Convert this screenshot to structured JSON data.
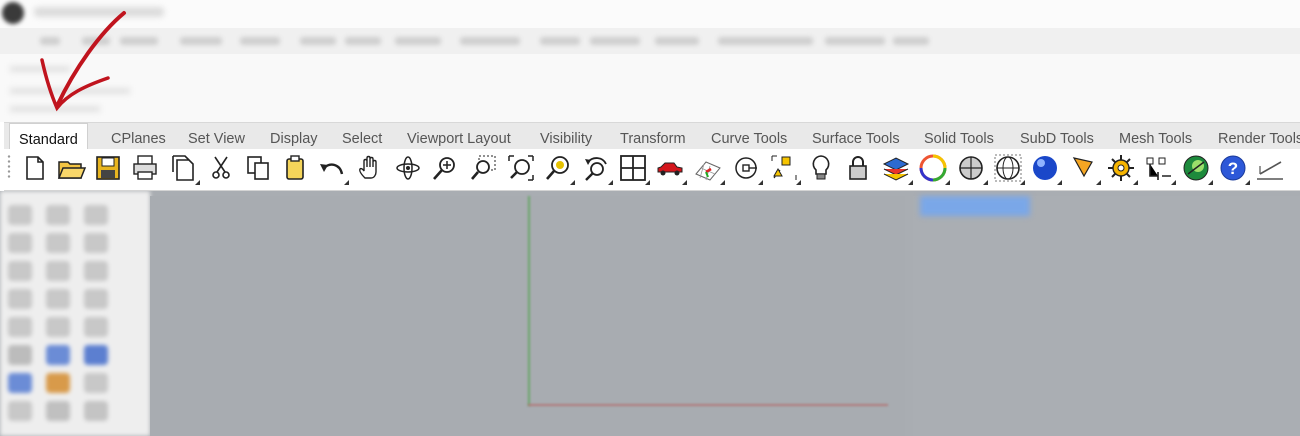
{
  "tabs": [
    {
      "label": "Standard",
      "active": true
    },
    {
      "label": "CPlanes",
      "active": false
    },
    {
      "label": "Set View",
      "active": false
    },
    {
      "label": "Display",
      "active": false
    },
    {
      "label": "Select",
      "active": false
    },
    {
      "label": "Viewport Layout",
      "active": false
    },
    {
      "label": "Visibility",
      "active": false
    },
    {
      "label": "Transform",
      "active": false
    },
    {
      "label": "Curve Tools",
      "active": false
    },
    {
      "label": "Surface Tools",
      "active": false
    },
    {
      "label": "Solid Tools",
      "active": false
    },
    {
      "label": "SubD Tools",
      "active": false
    },
    {
      "label": "Mesh Tools",
      "active": false
    },
    {
      "label": "Render Tools",
      "active": false
    }
  ],
  "toolbar_icons": [
    "new-document-icon",
    "open-folder-icon",
    "save-icon",
    "print-icon",
    "import-icon",
    "cut-icon",
    "copy-icon",
    "paste-icon",
    "undo-icon",
    "pan-hand-icon",
    "rotate-view-icon",
    "zoom-dynamic-icon",
    "zoom-window-icon",
    "zoom-extents-icon",
    "zoom-selected-icon",
    "undo-view-icon",
    "four-viewports-icon",
    "car-options-icon",
    "grid-options-icon",
    "object-snap-icon",
    "point-edit-icon",
    "light-bulb-icon",
    "lock-icon",
    "layer-icon",
    "color-wheel-icon",
    "shaded-sphere-icon",
    "wireframe-sphere-icon",
    "render-sphere-icon",
    "spotlight-icon",
    "gear-settings-icon",
    "dimension-icon",
    "grasshopper-icon",
    "help-icon",
    "line-draw-icon"
  ],
  "colors": {
    "annotation_arrow": "#c0141e",
    "viewport_bg": "#a8acb1",
    "tab_strip": "#e9e9e9"
  }
}
